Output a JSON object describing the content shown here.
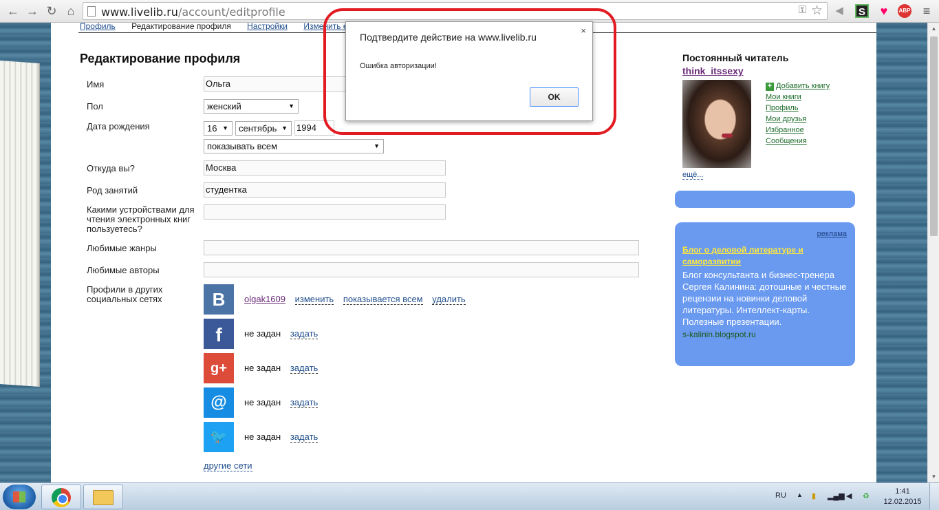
{
  "browser": {
    "url_host": "www.livelib.ru",
    "url_path": "/account/editprofile"
  },
  "subnav": {
    "items": [
      "Профиль",
      "Редактирование профиля",
      "Настройки",
      "Изменить email"
    ]
  },
  "form": {
    "title": "Редактирование профиля",
    "name_label": "Имя",
    "name_value": "Ольга",
    "gender_label": "Пол",
    "gender_value": "женский",
    "birth_label": "Дата рождения",
    "birth_day": "16",
    "birth_month": "сентябрь",
    "birth_year": "1994",
    "birth_visibility": "показывать всем",
    "city_label": "Откуда вы?",
    "city_value": "Москва",
    "job_label": "Род занятий",
    "job_value": "студентка",
    "devices_label": "Какими устройствами для чтения электронных книг пользуетесь?",
    "devices_value": "",
    "genres_label": "Любимые жанры",
    "genres_value": "",
    "authors_label": "Любимые авторы",
    "authors_value": "",
    "social_label": "Профили в других социальных сетях"
  },
  "social": {
    "vk": {
      "glyph": "B",
      "user": "olgak1609",
      "change": "изменить",
      "visibility": "показывается всем",
      "delete": "удалить"
    },
    "facebook": {
      "glyph": "f",
      "status": "не задан",
      "set": "задать"
    },
    "gplus": {
      "glyph": "g+",
      "status": "не задан",
      "set": "задать"
    },
    "mailru": {
      "glyph": "@",
      "status": "не задан",
      "set": "задать"
    },
    "twitter": {
      "glyph": "🐦",
      "status": "не задан",
      "set": "задать"
    },
    "other": "другие сети",
    "colors": {
      "vk": "#4b73a5",
      "facebook": "#3b5998",
      "gplus": "#dd4b39",
      "mailru": "#168de2",
      "twitter": "#1da1f2"
    }
  },
  "sidebar": {
    "title": "Постоянный читатель",
    "username": "think_itssexy",
    "links": [
      "Добавить книгу",
      "Мои книги",
      "Профиль",
      "Мои друзья",
      "Избранное",
      "Сообщения"
    ],
    "more": "ещё..."
  },
  "ad": {
    "label": "реклама",
    "title": "Блог о деловой литературе и саморазвитии",
    "body": "Блог консультанта и бизнес-тренера Сергея Калинина: дотошные и честные рецензии на новинки деловой литературы. Интеллект-карты. Полезные презентации.",
    "url": "s-kalinin.blogspot.ru"
  },
  "dialog": {
    "title": "Подтвердите действие на www.livelib.ru",
    "message": "Ошибка авторизации!",
    "ok": "OK",
    "close": "×"
  },
  "taskbar": {
    "lang": "RU",
    "time": "1:41",
    "date": "12.02.2015"
  }
}
